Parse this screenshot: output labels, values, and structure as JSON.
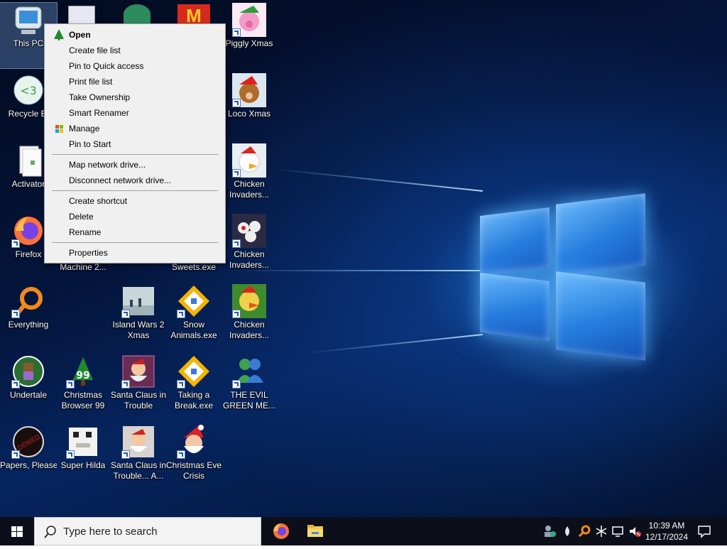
{
  "desktop": {
    "icons": [
      {
        "id": "this-pc",
        "label": "This PC",
        "label2": ""
      },
      {
        "id": "recycle-bin",
        "label": "Recycle Bi",
        "label2": ""
      },
      {
        "id": "activator",
        "label": "Activator",
        "label2": ""
      },
      {
        "id": "firefox",
        "label": "Firefox",
        "label2": ""
      },
      {
        "id": "everything",
        "label": "Everything",
        "label2": ""
      },
      {
        "id": "undertale",
        "label": "Undertale",
        "label2": ""
      },
      {
        "id": "papers-please",
        "label": "Papers, Please",
        "label2": ""
      },
      {
        "id": "machine",
        "label": "Machine 2...",
        "label2": ""
      },
      {
        "id": "christmas-browser",
        "label": "Christmas",
        "label2": "Browser 99"
      },
      {
        "id": "super-hilda",
        "label": "Super Hilda",
        "label2": ""
      },
      {
        "id": "island-wars",
        "label": "Island Wars 2",
        "label2": "Xmas"
      },
      {
        "id": "santa-trouble",
        "label": "Santa Claus in",
        "label2": "Trouble"
      },
      {
        "id": "santa-trouble-a",
        "label": "Santa Claus in",
        "label2": "Trouble... A..."
      },
      {
        "id": "sweets",
        "label": "Sweets.exe",
        "label2": ""
      },
      {
        "id": "snow-animals",
        "label": "Snow",
        "label2": "Animals.exe"
      },
      {
        "id": "taking-break",
        "label": "Taking a",
        "label2": "Break.exe"
      },
      {
        "id": "christmas-eve",
        "label": "Christmas Eve",
        "label2": "Crisis"
      },
      {
        "id": "piggly",
        "label": "Piggly Xmas",
        "label2": ""
      },
      {
        "id": "loco",
        "label": "Loco Xmas",
        "label2": ""
      },
      {
        "id": "chicken1",
        "label": "Chicken",
        "label2": "Invaders..."
      },
      {
        "id": "chicken2",
        "label": "Chicken",
        "label2": "Invaders..."
      },
      {
        "id": "chicken3",
        "label": "Chicken",
        "label2": "Invaders..."
      },
      {
        "id": "evil-green",
        "label": "THE EVIL",
        "label2": "GREEN ME..."
      }
    ]
  },
  "context_menu": {
    "items": [
      {
        "label": "Open",
        "bold": true
      },
      {
        "label": "Create file list"
      },
      {
        "label": "Pin to Quick access"
      },
      {
        "label": "Print file list"
      },
      {
        "label": "Take Ownership"
      },
      {
        "label": "Smart Renamer"
      },
      {
        "label": "Manage"
      },
      {
        "label": "Pin to Start"
      },
      {
        "label": "Map network drive..."
      },
      {
        "label": "Disconnect network drive..."
      },
      {
        "label": "Create shortcut"
      },
      {
        "label": "Delete"
      },
      {
        "label": "Rename"
      },
      {
        "label": "Properties"
      }
    ]
  },
  "taskbar": {
    "search_placeholder": "Type here to search",
    "apps": [
      "firefox-icon",
      "file-explorer-icon"
    ],
    "tray_icons": [
      "network-user-icon",
      "drop-icon",
      "search-tool-icon",
      "snowflake-icon",
      "display-icon",
      "volume-muted-icon"
    ],
    "time": "10:39 AM",
    "date": "12/17/2024",
    "accent": "#0078d7"
  }
}
